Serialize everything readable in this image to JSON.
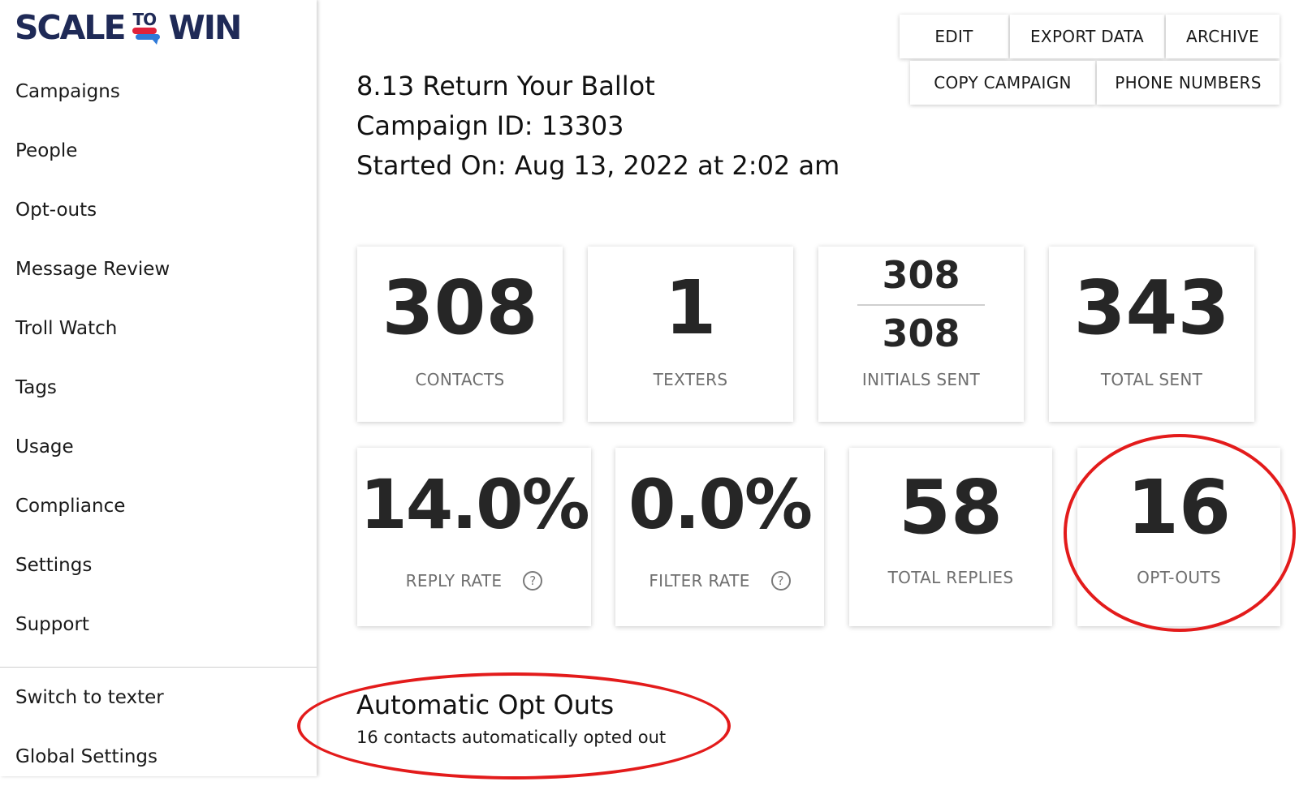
{
  "brand": {
    "logo_left": "SCALE",
    "logo_mid": "TO",
    "logo_right": "WIN",
    "colors": {
      "navy": "#1f2a57",
      "red": "#e0223b",
      "blue": "#2f7ad8"
    }
  },
  "sidebar": {
    "items": [
      {
        "label": "Campaigns"
      },
      {
        "label": "People"
      },
      {
        "label": "Opt-outs"
      },
      {
        "label": "Message Review"
      },
      {
        "label": "Troll Watch"
      },
      {
        "label": "Tags"
      },
      {
        "label": "Usage"
      },
      {
        "label": "Compliance"
      },
      {
        "label": "Settings"
      },
      {
        "label": "Support"
      }
    ],
    "bottom_items": [
      {
        "label": "Switch to texter"
      },
      {
        "label": "Global Settings"
      }
    ]
  },
  "actions": {
    "edit": "EDIT",
    "export": "EXPORT DATA",
    "archive": "ARCHIVE",
    "copy": "COPY CAMPAIGN",
    "phone": "PHONE NUMBERS"
  },
  "campaign": {
    "title": "8.13 Return Your Ballot",
    "id_line": "Campaign ID: 13303",
    "started_line": "Started On: Aug 13, 2022 at 2:02 am"
  },
  "stats": {
    "contacts": {
      "value": "308",
      "label": "CONTACTS"
    },
    "texters": {
      "value": "1",
      "label": "TEXTERS"
    },
    "initials": {
      "sent": "308",
      "total": "308",
      "label": "INITIALS SENT"
    },
    "total_sent": {
      "value": "343",
      "label": "TOTAL SENT"
    },
    "reply_rate": {
      "value": "14.0%",
      "label": "REPLY RATE",
      "help": "?"
    },
    "filter_rate": {
      "value": "0.0%",
      "label": "FILTER RATE",
      "help": "?"
    },
    "total_replies": {
      "value": "58",
      "label": "TOTAL REPLIES"
    },
    "opt_outs": {
      "value": "16",
      "label": "OPT-OUTS"
    }
  },
  "auto_opt_outs": {
    "title": "Automatic Opt Outs",
    "subtitle": "16 contacts automatically opted out"
  },
  "annotation_color": "#e31b1b"
}
